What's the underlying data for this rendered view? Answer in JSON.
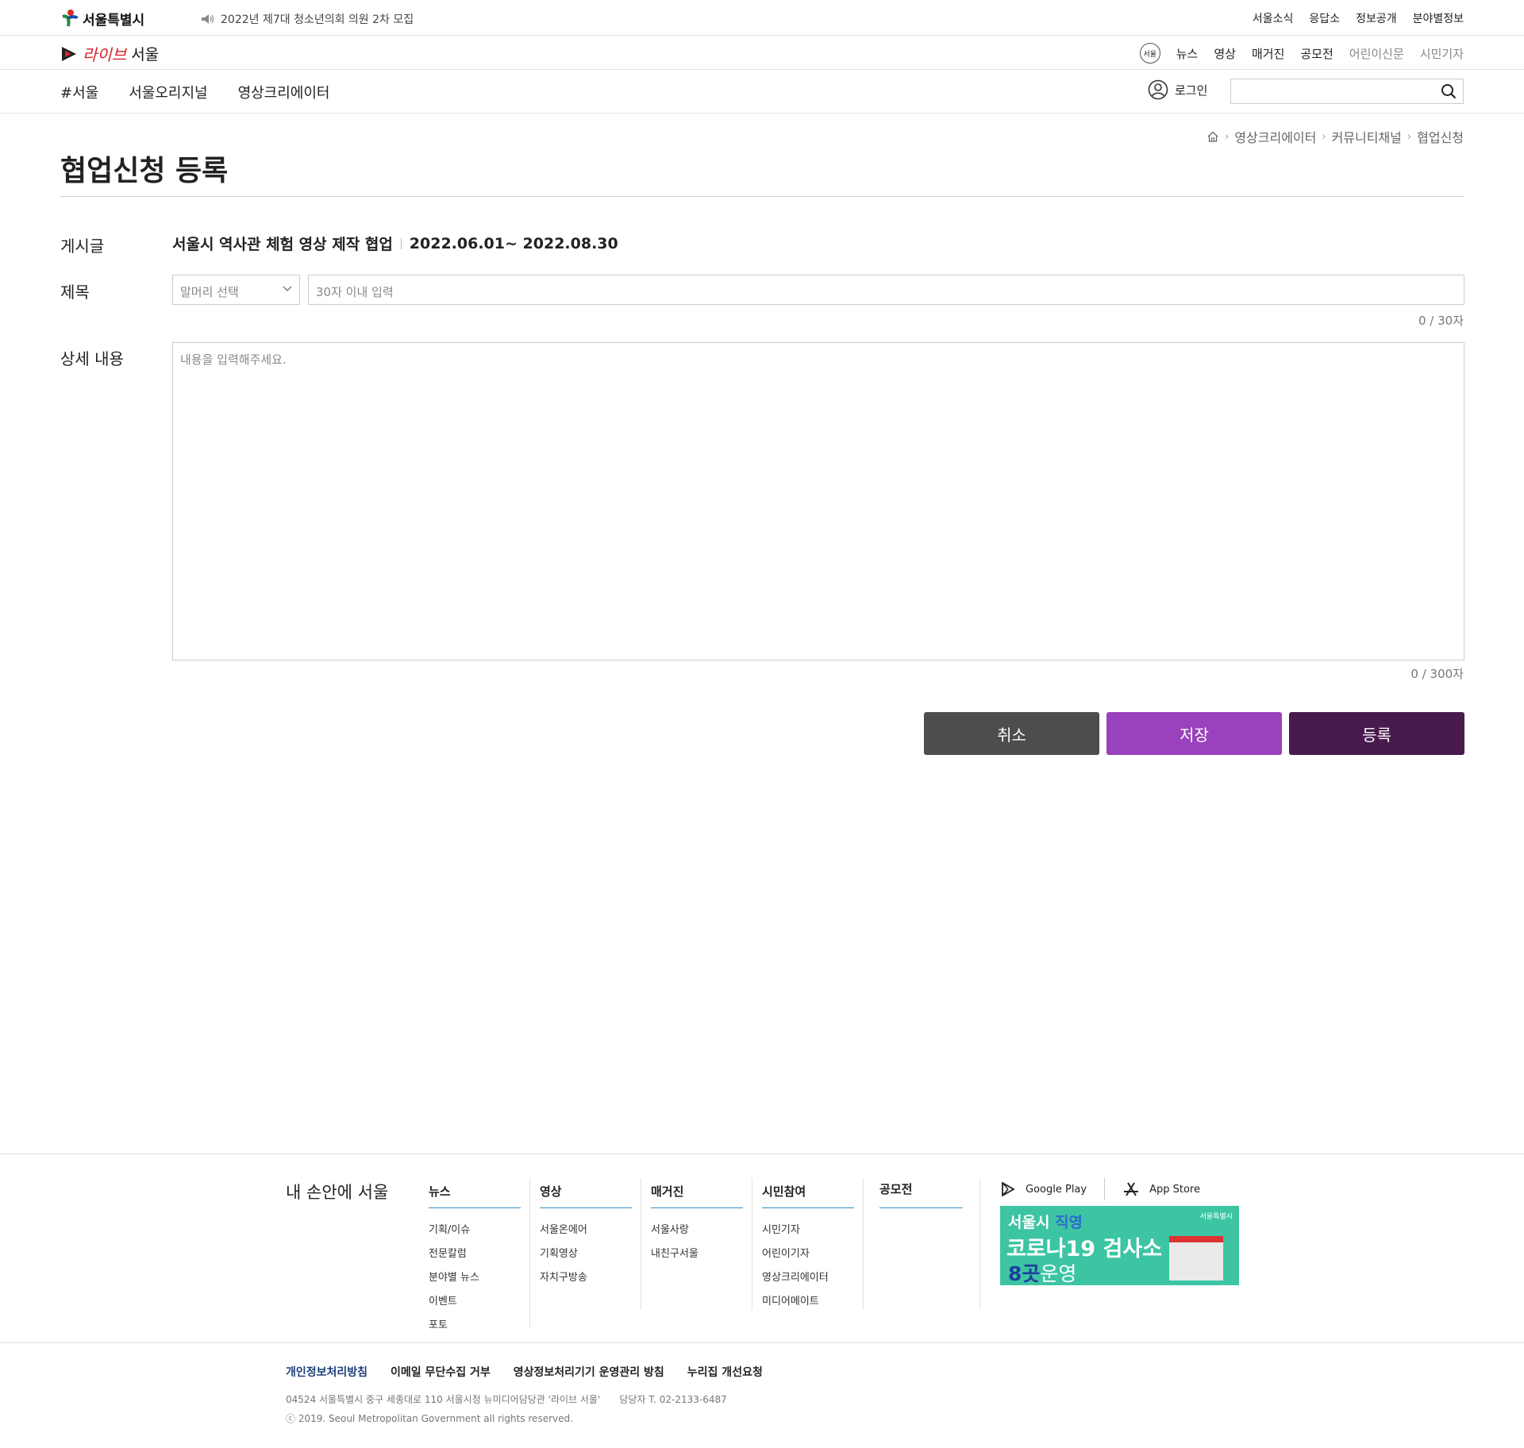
{
  "topbar": {
    "logo_text": "서울특별시",
    "notice": "2022년 제7대 청소년의회 의원 2차 모집",
    "links": [
      "서울소식",
      "응답소",
      "정보공개",
      "분야별정보"
    ]
  },
  "brand": {
    "live": "라이브",
    "seoul": "서울",
    "badge": "서울",
    "nav": [
      "뉴스",
      "영상",
      "매거진",
      "공모전"
    ],
    "nav_muted": [
      "어린이신문",
      "시민기자"
    ]
  },
  "mainnav": {
    "items": [
      "#서울",
      "서울오리지널",
      "영상크리에이터"
    ],
    "login": "로그인"
  },
  "breadcrumb": [
    "영상크리에이터",
    "커뮤니티채널",
    "협업신청"
  ],
  "page": {
    "title": "협업신청 등록"
  },
  "form": {
    "post_label": "게시글",
    "post_title": "서울시 역사관 체험 영상 제작 협업",
    "post_period": "2022.06.01~ 2022.08.30",
    "subject_label": "제목",
    "select_placeholder": "말머리 선택",
    "title_placeholder": "30자 이내 입력",
    "title_count": "0 / 30자",
    "content_label": "상세 내용",
    "content_placeholder": "내용을 입력해주세요.",
    "content_count": "0 / 300자",
    "cancel": "취소",
    "save": "저장",
    "submit": "등록"
  },
  "footer": {
    "slogan": "내 손안에 서울",
    "columns": [
      {
        "head": "뉴스",
        "items": [
          "기획/이슈",
          "전문칼럼",
          "분야별 뉴스",
          "이벤트",
          "포토"
        ]
      },
      {
        "head": "영상",
        "items": [
          "서울온에어",
          "기획영상",
          "자치구방송"
        ]
      },
      {
        "head": "매거진",
        "items": [
          "서울사랑",
          "내친구서울"
        ]
      },
      {
        "head": "시민참여",
        "items": [
          "시민기자",
          "어린이기자",
          "영상크리에이터",
          "미디어메이트"
        ]
      },
      {
        "head": "공모전",
        "items": []
      }
    ],
    "google_play": "Google Play",
    "app_store": "App Store",
    "banner": {
      "brand": "서울특별시",
      "line1a": "서울시 ",
      "line1b": "직영",
      "line2": "코로나19 검사소",
      "line3a": "8곳",
      "line3b": "운영"
    },
    "policies": [
      "개인정보처리방침",
      "이메일 무단수집 거부",
      "영상정보처리기기 운영관리 방침",
      "누리집 개선요청"
    ],
    "address": "04524 서울특별시 중구 세종대로 110 서울시청 뉴미디어담당관 '라이브 서울'",
    "contact": "담당자 T. 02-2133-6487",
    "copyright": "ⓒ 2019. Seoul Metropolitan Government all rights reserved."
  }
}
